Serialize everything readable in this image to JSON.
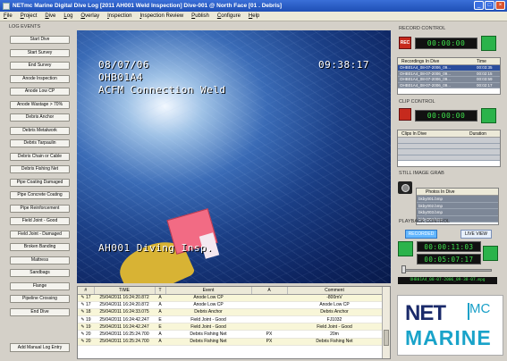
{
  "window": {
    "title": "NETmc Marine Digital Dive Log [2011 AH001 Weld Inspection] Dive-001 @ North Face [01 . Debris]"
  },
  "menu": [
    "File",
    "Project",
    "Dive",
    "Log",
    "Overlay",
    "Inspection",
    "Inspection Review",
    "Publish",
    "Configure",
    "Help"
  ],
  "log_events": {
    "header": "LOG EVENTS",
    "buttons": [
      "Start Dive",
      "Start Survey",
      "End Survey",
      "Anode Inspection",
      "Anode Low CP",
      "Anode Wastage > 70%",
      "Debris Anchor",
      "Debris Metalwork",
      "Debris Tarpaulin",
      "Debris Chain or Cable",
      "Debris Fishing Net",
      "Pipe Coating Damaged",
      "Pipe Concrete Coating",
      "Pipe Reinforcement",
      "Field Joint - Good",
      "Field Joint - Damaged",
      "Broken Banding",
      "Mattress",
      "Sandbags",
      "Flange",
      "Pipeline Crossing",
      "End Dive"
    ],
    "add_manual": "Add Manual Log Entry"
  },
  "video": {
    "date": "08/07/06",
    "time": "09:38:17",
    "line1": "OHB01A4",
    "line2": "ACFM Connection Weld",
    "subtitle": "AH001 Diving Insp."
  },
  "log_table": {
    "columns": [
      "#",
      "TIME",
      "T",
      "Event",
      "A",
      "Comment"
    ],
    "rows": [
      {
        "n": "17",
        "time": "25/04/2011 16:24:20.872",
        "t": "A",
        "event": "Anode Low CP",
        "a": "",
        "comment": "-800mV"
      },
      {
        "n": "17",
        "time": "25/04/2011 16:24:20.872",
        "t": "A",
        "event": "Anode Low CP",
        "a": "",
        "comment": "Anode Low CP"
      },
      {
        "n": "18",
        "time": "25/04/2011 16:24:33.075",
        "t": "A",
        "event": "Debris Anchor",
        "a": "",
        "comment": "Debris Anchor"
      },
      {
        "n": "19",
        "time": "25/04/2011 16:24:42.247",
        "t": "E",
        "event": "Field Joint - Good",
        "a": "",
        "comment": "FJ1032"
      },
      {
        "n": "19",
        "time": "25/04/2011 16:24:42.247",
        "t": "E",
        "event": "Field Joint - Good",
        "a": "",
        "comment": "Field Joint - Good"
      },
      {
        "n": "20",
        "time": "25/04/2011 16:25:24.700",
        "t": "A",
        "event": "Debris Fishing Net",
        "a": "PX",
        "comment": "20m"
      },
      {
        "n": "20",
        "time": "25/04/2011 16:25:24.700",
        "t": "A",
        "event": "Debris Fishing Net",
        "a": "PX",
        "comment": "Debris Fishing Net"
      }
    ]
  },
  "record_control": {
    "title": "RECORD CONTROL",
    "rec_label": "REC",
    "timer": "00:00:00",
    "columns": [
      "Recordings In Dive",
      "Time"
    ],
    "rows": [
      {
        "name": "OHB01A4_08-07-2006_09...",
        "time": "00:03:35"
      },
      {
        "name": "OHB01A4_08-07-2006_09...",
        "time": "00:02:15"
      },
      {
        "name": "OHB01A4_08-07-2006_09...",
        "time": "00:03:59"
      },
      {
        "name": "OHB01A4_08-07-2006_09...",
        "time": "00:02:17"
      }
    ]
  },
  "clip_control": {
    "title": "CLIP CONTROL",
    "timer": "00:00:00",
    "columns": [
      "Clips In Dive",
      "Duration"
    ]
  },
  "still_image": {
    "title": "STILL IMAGE GRAB",
    "column": "Photos In Dive",
    "photos": [
      "bkby001.bmp",
      "bkby002.bmp",
      "bkby003.bmp",
      "bkby004.bmp"
    ]
  },
  "playback": {
    "title": "PLAYBACK CONTROL",
    "btn_left": "RECORDED",
    "btn_right": "LIVE VIEW",
    "timer1": "00:00:11:03",
    "timer2": "00:05:07:17",
    "filename": "OHB01A4_08-07-2006_09-38-07.mpg"
  },
  "logo": {
    "net": "NET",
    "mc": "MC",
    "marine": "MARINE"
  },
  "colors": {
    "accent": "#1f4fb5",
    "timer_green": "#3fe34d",
    "go_green": "#2bb34b",
    "rec_red": "#c62a1d"
  }
}
